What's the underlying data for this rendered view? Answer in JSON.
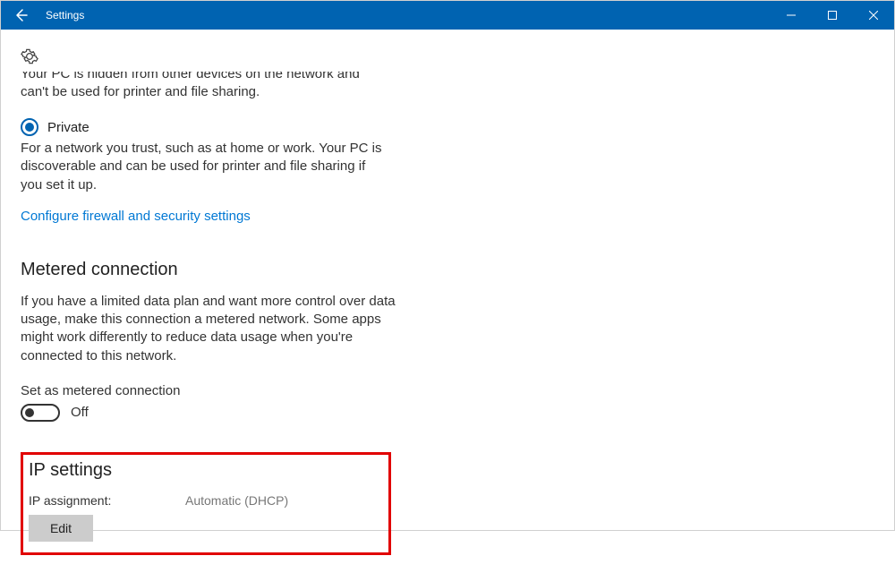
{
  "window": {
    "title": "Settings"
  },
  "network": {
    "hidden_desc": "Your PC is hidden from other devices on the network and can't be used for printer and file sharing.",
    "private_label": "Private",
    "private_desc": "For a network you trust, such as at home or work. Your PC is discoverable and can be used for printer and file sharing if you set it up.",
    "firewall_link": "Configure firewall and security settings"
  },
  "metered": {
    "heading": "Metered connection",
    "desc": "If you have a limited data plan and want more control over data usage, make this connection a metered network. Some apps might work differently to reduce data usage when you're connected to this network.",
    "toggle_label": "Set as metered connection",
    "toggle_state": "Off"
  },
  "ip": {
    "heading": "IP settings",
    "assignment_label": "IP assignment:",
    "assignment_value": "Automatic (DHCP)",
    "edit_label": "Edit"
  }
}
